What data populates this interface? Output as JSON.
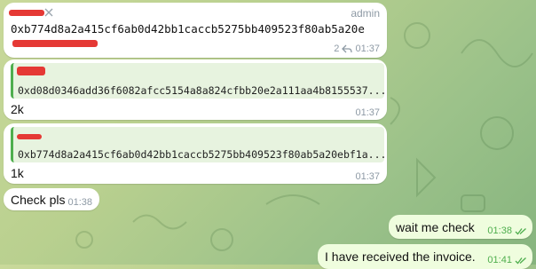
{
  "messages": [
    {
      "id": "m1",
      "badge": "admin",
      "text": "0xb774d8a2a415cf6ab0d42bb1caccb5275bb409523f80ab5a20e",
      "replies_count": "2",
      "time": "01:37"
    },
    {
      "id": "m2",
      "quote_text": "0xd08d0346add36f6082afcc5154a8a824cfbb20e2a111aa4b8155537...",
      "text": "2k",
      "time": "01:37"
    },
    {
      "id": "m3",
      "quote_text": "0xb774d8a2a415cf6ab0d42bb1caccb5275bb409523f80ab5a20ebf1a...",
      "text": "1k",
      "time": "01:37"
    },
    {
      "id": "m4",
      "text": "Check pls",
      "time": "01:38"
    },
    {
      "id": "m5",
      "text": "wait me check",
      "time": "01:38",
      "status_icon": "double-check-icon"
    },
    {
      "id": "m6",
      "text": "I have received the invoice.",
      "time": "01:41",
      "status_icon": "double-check-icon"
    }
  ],
  "colors": {
    "accent_green": "#4fae4e",
    "redaction_red": "#e53935",
    "incoming_bubble": "#ffffff",
    "outgoing_bubble": "#effdde"
  }
}
